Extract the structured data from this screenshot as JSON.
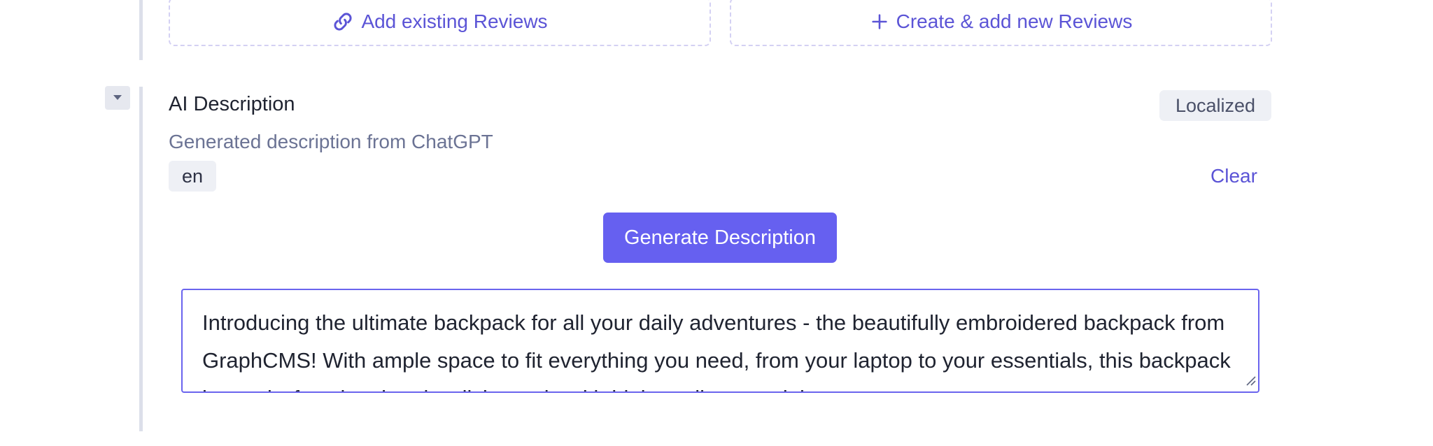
{
  "reviews": {
    "add_existing_label": "Add existing Reviews",
    "create_new_label": "Create & add new Reviews"
  },
  "field": {
    "title": "AI Description",
    "description": "Generated description from ChatGPT",
    "localized_badge": "Localized",
    "locale": "en",
    "clear_label": "Clear"
  },
  "generate_button_label": "Generate Description",
  "textarea": {
    "value": "Introducing the ultimate backpack for all your daily adventures - the beautifully embroidered backpack from GraphCMS! With ample space to fit everything you need, from your laptop to your essentials, this backpack is sturdy, functional and stylish, made with high quality materials."
  },
  "colors": {
    "accent": "#6660f0",
    "link": "#5b54d6",
    "badge_bg": "#eef0f5",
    "muted_text": "#6b7394"
  },
  "icons": {
    "add_existing": "link-icon",
    "create_new": "plus-icon",
    "collapse": "caret-down-icon",
    "resize": "resize-handle-icon"
  }
}
